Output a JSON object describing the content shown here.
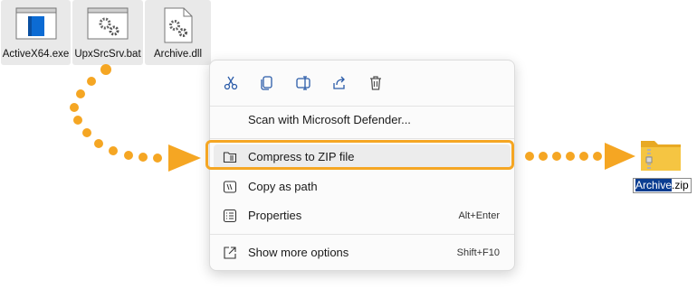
{
  "files": [
    {
      "name": "ActiveX64.exe",
      "icon": "exe-window-icon"
    },
    {
      "name": "UpxSrcSrv.bat",
      "icon": "batch-gear-icon"
    },
    {
      "name": "Archive.dll",
      "icon": "dll-gear-icon"
    }
  ],
  "toolbar": [
    "cut-icon",
    "copy-icon",
    "rename-icon",
    "share-icon",
    "delete-icon"
  ],
  "menu": {
    "scan": {
      "label": "Scan with Microsoft Defender...",
      "shortcut": ""
    },
    "compress": {
      "label": "Compress to ZIP file",
      "shortcut": ""
    },
    "copy_path": {
      "label": "Copy as path",
      "shortcut": ""
    },
    "properties": {
      "label": "Properties",
      "shortcut": "Alt+Enter"
    },
    "more": {
      "label": "Show more options",
      "shortcut": "Shift+F10"
    }
  },
  "result": {
    "name_selected": "Archive",
    "name_ext": ".zip",
    "icon": "zip-folder-icon"
  },
  "colors": {
    "accent": "#f5a623",
    "selection": "#0a3d91",
    "folder": "#f5c542"
  }
}
